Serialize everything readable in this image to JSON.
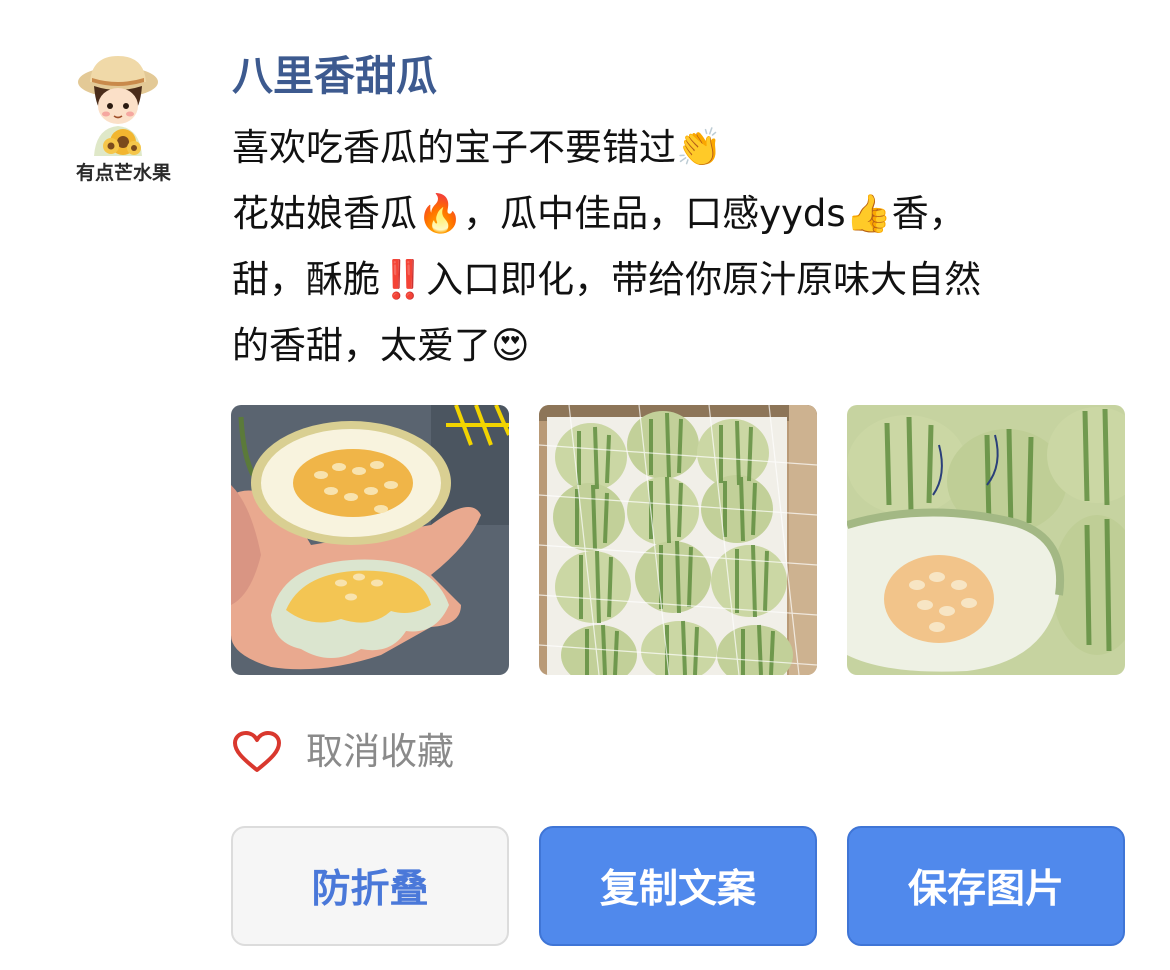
{
  "account": {
    "avatar_caption": "有点芒水果",
    "name": "八里香甜瓜"
  },
  "post": {
    "lines": [
      "喜欢吃香瓜的宝子不要错过👏",
      "花姑娘香瓜🔥，瓜中佳品，口感yyds👍香，",
      "甜，酥脆‼️入口即化，带给你原汁原味大自然",
      "的香甜，太爱了😍"
    ]
  },
  "photos": [
    {
      "icon": "melon-halves-in-hand"
    },
    {
      "icon": "melons-in-box"
    },
    {
      "icon": "cut-melon-closeup"
    }
  ],
  "favorite": {
    "icon": "heart-outline-icon",
    "label": "取消收藏",
    "color": "#d9382e"
  },
  "actions": {
    "fold_label": "防折叠",
    "copy_label": "复制文案",
    "save_label": "保存图片"
  },
  "colors": {
    "title": "#3d5a8f",
    "primary_button": "#5089ec",
    "secondary_button_text": "#4a78d9",
    "muted_text": "#8a8a8a"
  }
}
